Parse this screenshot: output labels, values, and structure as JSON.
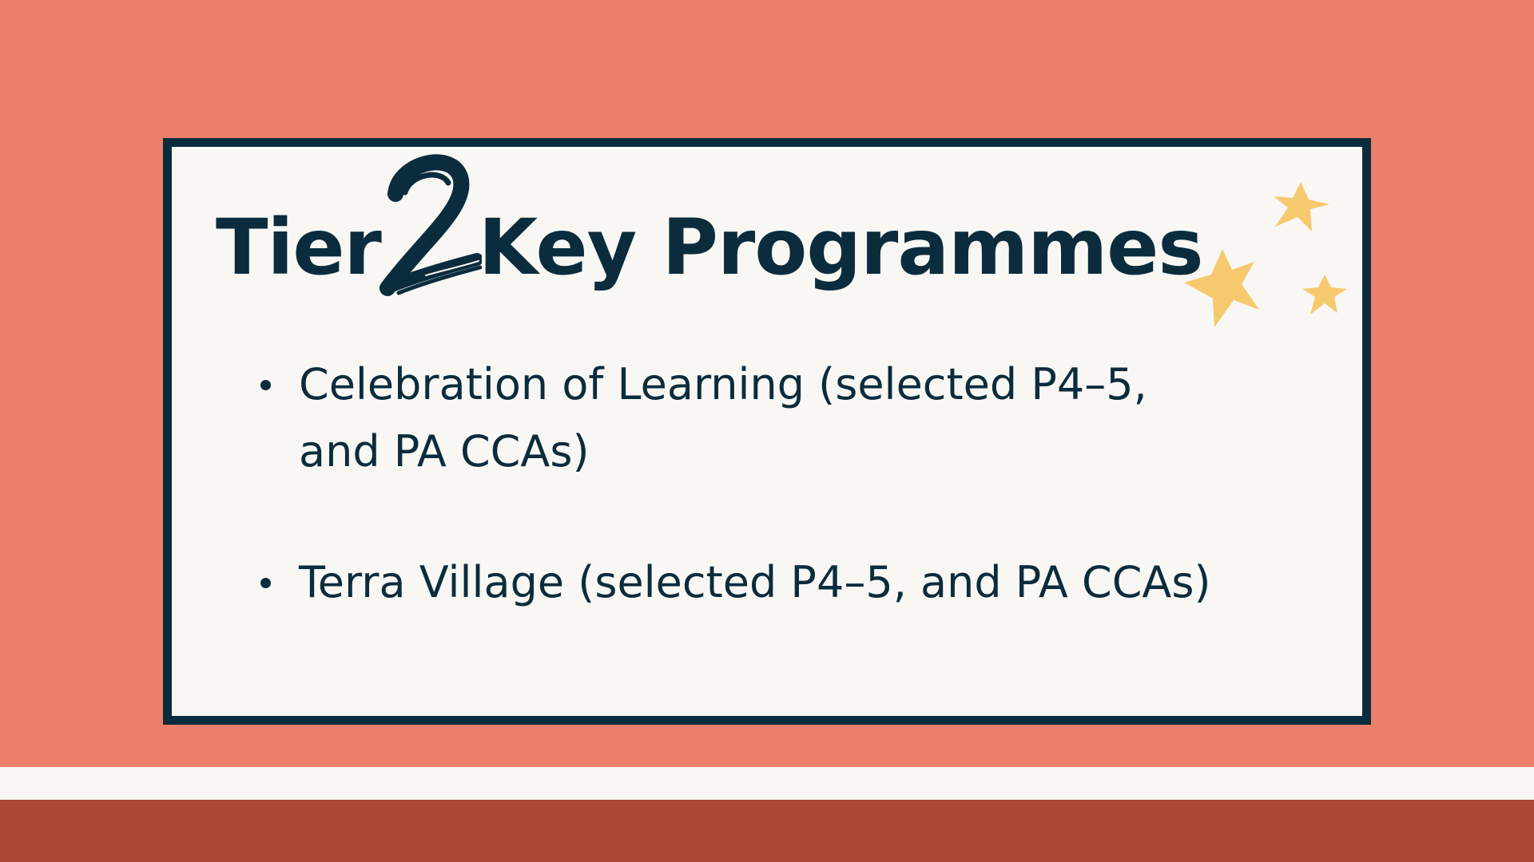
{
  "slide": {
    "title_prefix": "Tier",
    "title_number": "2",
    "title_suffix": "Key Programmes",
    "bullets": [
      {
        "text": "Celebration of Learning (selected P4–5, and PA CCAs)"
      },
      {
        "text": "Terra Village (selected P4–5, and PA CCAs)"
      }
    ]
  },
  "colors": {
    "background": "#ED806B",
    "card": "#F8F7F3",
    "ink": "#0B2C3D",
    "star": "#F7C96E",
    "footer_band_light": "#F8F7F3",
    "footer_band_dark": "#AB4732"
  },
  "decorations": {
    "icon": "three-stars-icon"
  }
}
